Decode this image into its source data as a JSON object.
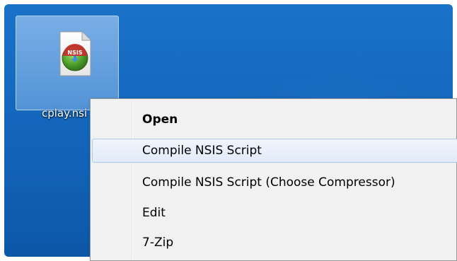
{
  "desktop_icon": {
    "label": "cplay.nsi",
    "badge": "NSIS",
    "icon": "nsis-script-file-icon"
  },
  "context_menu": {
    "items": [
      {
        "label": "Open",
        "bold": true
      },
      {
        "label": "Compile NSIS Script",
        "highlighted": true
      },
      {
        "label": "Compile NSIS Script (Choose Compressor)"
      },
      {
        "label": "Edit"
      },
      {
        "label": "7-Zip"
      }
    ]
  },
  "colors": {
    "desktop": "#1668c0",
    "menu_background": "#f1f1f1",
    "highlight_border": "#a8c7ec"
  }
}
